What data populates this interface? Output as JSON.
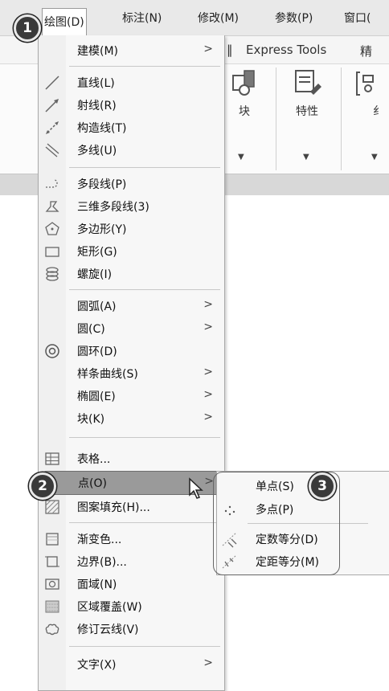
{
  "menubar": {
    "items": [
      "绘图(D)",
      "标注(N)",
      "修改(M)",
      "参数(P)",
      "窗口("
    ]
  },
  "ribbon": {
    "tabs": [
      "Express Tools",
      "精"
    ],
    "buttons": [
      "块",
      "特性",
      "纟"
    ]
  },
  "menu": {
    "items": [
      {
        "label": "建模(M)",
        "icon": "none",
        "submenu": true
      },
      {
        "label": "直线(L)",
        "icon": "line-icon",
        "submenu": false
      },
      {
        "label": "射线(R)",
        "icon": "ray-icon",
        "submenu": false
      },
      {
        "label": "构造线(T)",
        "icon": "construction-line-icon",
        "submenu": false
      },
      {
        "label": "多线(U)",
        "icon": "multiline-icon",
        "submenu": false
      },
      {
        "label": "多段线(P)",
        "icon": "polyline-icon",
        "submenu": false
      },
      {
        "label": "三维多段线(3)",
        "icon": "3d-polyline-icon",
        "submenu": false
      },
      {
        "label": "多边形(Y)",
        "icon": "polygon-icon",
        "submenu": false
      },
      {
        "label": "矩形(G)",
        "icon": "rectangle-icon",
        "submenu": false
      },
      {
        "label": "螺旋(I)",
        "icon": "helix-icon",
        "submenu": false
      },
      {
        "label": "圆弧(A)",
        "icon": "none",
        "submenu": true
      },
      {
        "label": "圆(C)",
        "icon": "none",
        "submenu": true
      },
      {
        "label": "圆环(D)",
        "icon": "donut-icon",
        "submenu": false
      },
      {
        "label": "样条曲线(S)",
        "icon": "none",
        "submenu": true
      },
      {
        "label": "椭圆(E)",
        "icon": "none",
        "submenu": true
      },
      {
        "label": "块(K)",
        "icon": "none",
        "submenu": true
      },
      {
        "label": "表格...",
        "icon": "table-icon",
        "submenu": false
      },
      {
        "label": "点(O)",
        "icon": "point-icon",
        "submenu": true
      },
      {
        "label": "图案填充(H)...",
        "icon": "hatch-icon",
        "submenu": false
      },
      {
        "label": "渐变色...",
        "icon": "gradient-icon",
        "submenu": false
      },
      {
        "label": "边界(B)...",
        "icon": "boundary-icon",
        "submenu": false
      },
      {
        "label": "面域(N)",
        "icon": "region-icon",
        "submenu": false
      },
      {
        "label": "区域覆盖(W)",
        "icon": "wipeout-icon",
        "submenu": false
      },
      {
        "label": "修订云线(V)",
        "icon": "revcloud-icon",
        "submenu": false
      },
      {
        "label": "文字(X)",
        "icon": "none",
        "submenu": true
      }
    ],
    "arrow": ">"
  },
  "submenu": {
    "items": [
      {
        "label": "单点(S)",
        "icon": "single-point-icon"
      },
      {
        "label": "多点(P)",
        "icon": "multiple-points-icon"
      },
      {
        "label": "定数等分(D)",
        "icon": "divide-icon"
      },
      {
        "label": "定距等分(M)",
        "icon": "measure-icon"
      }
    ]
  },
  "badges": [
    "1",
    "2",
    "3"
  ]
}
